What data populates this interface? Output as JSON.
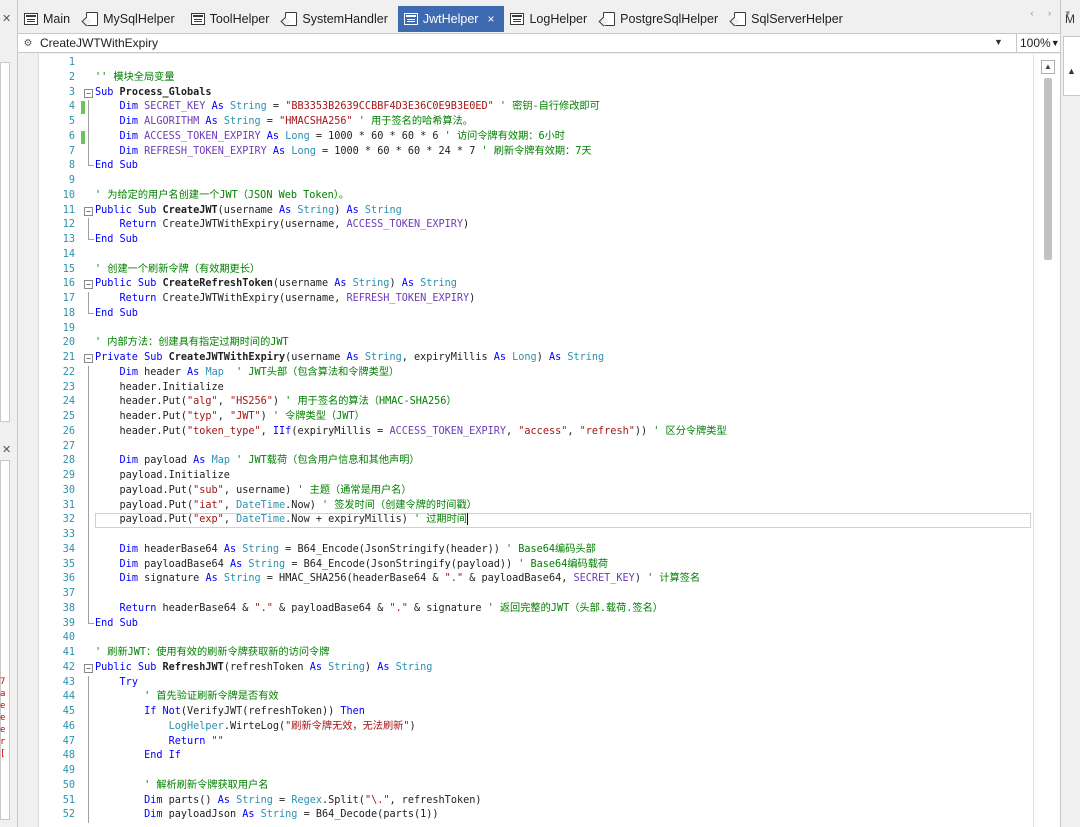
{
  "tabs": [
    {
      "label": "Main",
      "icon": "form-icon",
      "active": false
    },
    {
      "label": "MySqlHelper",
      "icon": "code-file-icon",
      "active": false
    },
    {
      "label": "ToolHelper",
      "icon": "form-icon",
      "active": false
    },
    {
      "label": "SystemHandler",
      "icon": "code-file-icon",
      "active": false
    },
    {
      "label": "JwtHelper",
      "icon": "form-icon",
      "active": true
    },
    {
      "label": "LogHelper",
      "icon": "form-icon",
      "active": false
    },
    {
      "label": "PostgreSqlHelper",
      "icon": "code-file-icon",
      "active": false
    },
    {
      "label": "SqlServerHelper",
      "icon": "code-file-icon",
      "active": false
    }
  ],
  "active_tab_close": "×",
  "member_bar": {
    "selected": "CreateJWTWithExpiry"
  },
  "zoom": {
    "value": "100%"
  },
  "side_panels": {
    "right_label": "M",
    "left_fragment": "7aeeer["
  },
  "accent_color": "#3d6ab0",
  "code": {
    "current_line": 32,
    "lines": [
      {
        "n": 1,
        "tokens": []
      },
      {
        "n": 2,
        "tokens": [
          [
            "c",
            "'' 模块全局变量"
          ]
        ]
      },
      {
        "n": 3,
        "fold": "minus",
        "tokens": [
          [
            "k",
            "Sub "
          ],
          [
            "b",
            "Process_Globals"
          ]
        ]
      },
      {
        "n": 4,
        "changed": true,
        "tokens": [
          [
            "p",
            "    "
          ],
          [
            "k",
            "Dim "
          ],
          [
            "v",
            "SECRET_KEY"
          ],
          [
            "k",
            " As "
          ],
          [
            "t",
            "String"
          ],
          [
            "p",
            " = "
          ],
          [
            "s",
            "\"BB3353B2639CCBBF4D3E36C0E9B3E0ED\""
          ],
          [
            "c",
            " ' 密钥-自行修改即可"
          ]
        ]
      },
      {
        "n": 5,
        "tokens": [
          [
            "p",
            "    "
          ],
          [
            "k",
            "Dim "
          ],
          [
            "v",
            "ALGORITHM"
          ],
          [
            "k",
            " As "
          ],
          [
            "t",
            "String"
          ],
          [
            "p",
            " = "
          ],
          [
            "s",
            "\"HMACSHA256\""
          ],
          [
            "c",
            " ' 用于签名的哈希算法。"
          ]
        ]
      },
      {
        "n": 6,
        "changed": true,
        "tokens": [
          [
            "p",
            "    "
          ],
          [
            "k",
            "Dim "
          ],
          [
            "v",
            "ACCESS_TOKEN_EXPIRY"
          ],
          [
            "k",
            " As "
          ],
          [
            "t",
            "Long"
          ],
          [
            "p",
            " = 1000 * 60 * 60 * 6"
          ],
          [
            "c",
            " ' 访问令牌有效期：6小时"
          ]
        ]
      },
      {
        "n": 7,
        "tokens": [
          [
            "p",
            "    "
          ],
          [
            "k",
            "Dim "
          ],
          [
            "v",
            "REFRESH_TOKEN_EXPIRY"
          ],
          [
            "k",
            " As "
          ],
          [
            "t",
            "Long"
          ],
          [
            "p",
            " = 1000 * 60 * 60 * 24 * 7"
          ],
          [
            "c",
            " ' 刷新令牌有效期：7天"
          ]
        ]
      },
      {
        "n": 8,
        "fold_end": true,
        "tokens": [
          [
            "k",
            "End Sub"
          ]
        ]
      },
      {
        "n": 9,
        "tokens": []
      },
      {
        "n": 10,
        "tokens": [
          [
            "c",
            "' 为给定的用户名创建一个JWT（JSON Web Token）。"
          ]
        ]
      },
      {
        "n": 11,
        "fold": "minus",
        "tokens": [
          [
            "k",
            "Public Sub "
          ],
          [
            "b",
            "CreateJWT"
          ],
          [
            "p",
            "(username "
          ],
          [
            "k",
            "As "
          ],
          [
            "t",
            "String"
          ],
          [
            "p",
            ") "
          ],
          [
            "k",
            "As "
          ],
          [
            "t",
            "String"
          ]
        ]
      },
      {
        "n": 12,
        "tokens": [
          [
            "p",
            "    "
          ],
          [
            "k",
            "Return "
          ],
          [
            "p",
            "CreateJWTWithExpiry(username, "
          ],
          [
            "v",
            "ACCESS_TOKEN_EXPIRY"
          ],
          [
            "p",
            ")"
          ]
        ]
      },
      {
        "n": 13,
        "fold_end": true,
        "tokens": [
          [
            "k",
            "End Sub"
          ]
        ]
      },
      {
        "n": 14,
        "tokens": []
      },
      {
        "n": 15,
        "tokens": [
          [
            "c",
            "' 创建一个刷新令牌（有效期更长）"
          ]
        ]
      },
      {
        "n": 16,
        "fold": "minus",
        "tokens": [
          [
            "k",
            "Public Sub "
          ],
          [
            "b",
            "CreateRefreshToken"
          ],
          [
            "p",
            "(username "
          ],
          [
            "k",
            "As "
          ],
          [
            "t",
            "String"
          ],
          [
            "p",
            ") "
          ],
          [
            "k",
            "As "
          ],
          [
            "t",
            "String"
          ]
        ]
      },
      {
        "n": 17,
        "tokens": [
          [
            "p",
            "    "
          ],
          [
            "k",
            "Return "
          ],
          [
            "p",
            "CreateJWTWithExpiry(username, "
          ],
          [
            "v",
            "REFRESH_TOKEN_EXPIRY"
          ],
          [
            "p",
            ")"
          ]
        ]
      },
      {
        "n": 18,
        "fold_end": true,
        "tokens": [
          [
            "k",
            "End Sub"
          ]
        ]
      },
      {
        "n": 19,
        "tokens": []
      },
      {
        "n": 20,
        "tokens": [
          [
            "c",
            "' 内部方法：创建具有指定过期时间的JWT"
          ]
        ]
      },
      {
        "n": 21,
        "fold": "minus",
        "tokens": [
          [
            "k",
            "Private Sub "
          ],
          [
            "b",
            "CreateJWTWithExpiry"
          ],
          [
            "p",
            "(username "
          ],
          [
            "k",
            "As "
          ],
          [
            "t",
            "String"
          ],
          [
            "p",
            ", expiryMillis "
          ],
          [
            "k",
            "As "
          ],
          [
            "t",
            "Long"
          ],
          [
            "p",
            ") "
          ],
          [
            "k",
            "As "
          ],
          [
            "t",
            "String"
          ]
        ]
      },
      {
        "n": 22,
        "tokens": [
          [
            "p",
            "    "
          ],
          [
            "k",
            "Dim "
          ],
          [
            "p",
            "header "
          ],
          [
            "k",
            "As "
          ],
          [
            "t",
            "Map"
          ],
          [
            "c",
            "  ' JWT头部（包含算法和令牌类型）"
          ]
        ]
      },
      {
        "n": 23,
        "tokens": [
          [
            "p",
            "    header.Initialize"
          ]
        ]
      },
      {
        "n": 24,
        "tokens": [
          [
            "p",
            "    header.Put("
          ],
          [
            "s",
            "\"alg\""
          ],
          [
            "p",
            ", "
          ],
          [
            "s",
            "\"HS256\""
          ],
          [
            "p",
            ")"
          ],
          [
            "c",
            " ' 用于签名的算法（HMAC-SHA256）"
          ]
        ]
      },
      {
        "n": 25,
        "tokens": [
          [
            "p",
            "    header.Put("
          ],
          [
            "s",
            "\"typ\""
          ],
          [
            "p",
            ", "
          ],
          [
            "s",
            "\"JWT\""
          ],
          [
            "p",
            ")"
          ],
          [
            "c",
            " ' 令牌类型（JWT）"
          ]
        ]
      },
      {
        "n": 26,
        "tokens": [
          [
            "p",
            "    header.Put("
          ],
          [
            "s",
            "\"token_type\""
          ],
          [
            "p",
            ", "
          ],
          [
            "k",
            "IIf"
          ],
          [
            "p",
            "(expiryMillis = "
          ],
          [
            "v",
            "ACCESS_TOKEN_EXPIRY"
          ],
          [
            "p",
            ", "
          ],
          [
            "s",
            "\"access\""
          ],
          [
            "p",
            ", "
          ],
          [
            "s",
            "\"refresh\""
          ],
          [
            "p",
            "))"
          ],
          [
            "c",
            " ' 区分令牌类型"
          ]
        ]
      },
      {
        "n": 27,
        "tokens": []
      },
      {
        "n": 28,
        "tokens": [
          [
            "p",
            "    "
          ],
          [
            "k",
            "Dim "
          ],
          [
            "p",
            "payload "
          ],
          [
            "k",
            "As "
          ],
          [
            "t",
            "Map"
          ],
          [
            "c",
            " ' JWT载荷（包含用户信息和其他声明）"
          ]
        ]
      },
      {
        "n": 29,
        "tokens": [
          [
            "p",
            "    payload.Initialize"
          ]
        ]
      },
      {
        "n": 30,
        "tokens": [
          [
            "p",
            "    payload.Put("
          ],
          [
            "s",
            "\"sub\""
          ],
          [
            "p",
            ", username)"
          ],
          [
            "c",
            " ' 主题（通常是用户名）"
          ]
        ]
      },
      {
        "n": 31,
        "tokens": [
          [
            "p",
            "    payload.Put("
          ],
          [
            "s",
            "\"iat\""
          ],
          [
            "p",
            ", "
          ],
          [
            "t",
            "DateTime"
          ],
          [
            "p",
            ".Now)"
          ],
          [
            "c",
            " ' 签发时间（创建令牌的时间戳）"
          ]
        ]
      },
      {
        "n": 32,
        "tokens": [
          [
            "p",
            "    payload.Put("
          ],
          [
            "s",
            "\"exp\""
          ],
          [
            "p",
            ", "
          ],
          [
            "t",
            "DateTime"
          ],
          [
            "p",
            ".Now + expiryMillis)"
          ],
          [
            "c",
            " ' 过期时间"
          ]
        ]
      },
      {
        "n": 33,
        "tokens": []
      },
      {
        "n": 34,
        "tokens": [
          [
            "p",
            "    "
          ],
          [
            "k",
            "Dim "
          ],
          [
            "p",
            "headerBase64 "
          ],
          [
            "k",
            "As "
          ],
          [
            "t",
            "String"
          ],
          [
            "p",
            " = B64_Encode(JsonStringify(header))"
          ],
          [
            "c",
            " ' Base64编码头部"
          ]
        ]
      },
      {
        "n": 35,
        "tokens": [
          [
            "p",
            "    "
          ],
          [
            "k",
            "Dim "
          ],
          [
            "p",
            "payloadBase64 "
          ],
          [
            "k",
            "As "
          ],
          [
            "t",
            "String"
          ],
          [
            "p",
            " = B64_Encode(JsonStringify(payload))"
          ],
          [
            "c",
            " ' Base64编码载荷"
          ]
        ]
      },
      {
        "n": 36,
        "tokens": [
          [
            "p",
            "    "
          ],
          [
            "k",
            "Dim "
          ],
          [
            "p",
            "signature "
          ],
          [
            "k",
            "As "
          ],
          [
            "t",
            "String"
          ],
          [
            "p",
            " = HMAC_SHA256(headerBase64 & "
          ],
          [
            "s",
            "\".\""
          ],
          [
            "p",
            " & payloadBase64, "
          ],
          [
            "v",
            "SECRET_KEY"
          ],
          [
            "p",
            ")"
          ],
          [
            "c",
            " ' 计算签名"
          ]
        ]
      },
      {
        "n": 37,
        "tokens": []
      },
      {
        "n": 38,
        "tokens": [
          [
            "p",
            "    "
          ],
          [
            "k",
            "Return "
          ],
          [
            "p",
            "headerBase64 & "
          ],
          [
            "s",
            "\".\""
          ],
          [
            "p",
            " & payloadBase64 & "
          ],
          [
            "s",
            "\".\""
          ],
          [
            "p",
            " & signature"
          ],
          [
            "c",
            " ' 返回完整的JWT（头部.载荷.签名）"
          ]
        ]
      },
      {
        "n": 39,
        "fold_end": true,
        "tokens": [
          [
            "k",
            "End Sub"
          ]
        ]
      },
      {
        "n": 40,
        "tokens": []
      },
      {
        "n": 41,
        "tokens": [
          [
            "c",
            "' 刷新JWT：使用有效的刷新令牌获取新的访问令牌"
          ]
        ]
      },
      {
        "n": 42,
        "fold": "minus",
        "tokens": [
          [
            "k",
            "Public Sub "
          ],
          [
            "b",
            "RefreshJWT"
          ],
          [
            "p",
            "(refreshToken "
          ],
          [
            "k",
            "As "
          ],
          [
            "t",
            "String"
          ],
          [
            "p",
            ") "
          ],
          [
            "k",
            "As "
          ],
          [
            "t",
            "String"
          ]
        ]
      },
      {
        "n": 43,
        "tokens": [
          [
            "p",
            "    "
          ],
          [
            "k",
            "Try"
          ]
        ]
      },
      {
        "n": 44,
        "tokens": [
          [
            "p",
            "        "
          ],
          [
            "c",
            "' 首先验证刷新令牌是否有效"
          ]
        ]
      },
      {
        "n": 45,
        "tokens": [
          [
            "p",
            "        "
          ],
          [
            "k",
            "If Not"
          ],
          [
            "p",
            "(VerifyJWT(refreshToken)) "
          ],
          [
            "k",
            "Then"
          ]
        ]
      },
      {
        "n": 46,
        "tokens": [
          [
            "p",
            "            "
          ],
          [
            "t",
            "LogHelper"
          ],
          [
            "p",
            ".WirteLog("
          ],
          [
            "s",
            "\"刷新令牌无效，无法刷新\""
          ],
          [
            "p",
            ")"
          ]
        ]
      },
      {
        "n": 47,
        "tokens": [
          [
            "p",
            "            "
          ],
          [
            "k",
            "Return "
          ],
          [
            "s",
            "\"\""
          ]
        ]
      },
      {
        "n": 48,
        "tokens": [
          [
            "p",
            "        "
          ],
          [
            "k",
            "End If"
          ]
        ]
      },
      {
        "n": 49,
        "tokens": []
      },
      {
        "n": 50,
        "tokens": [
          [
            "p",
            "        "
          ],
          [
            "c",
            "' 解析刷新令牌获取用户名"
          ]
        ]
      },
      {
        "n": 51,
        "tokens": [
          [
            "p",
            "        "
          ],
          [
            "k",
            "Dim "
          ],
          [
            "p",
            "parts() "
          ],
          [
            "k",
            "As "
          ],
          [
            "t",
            "String"
          ],
          [
            "p",
            " = "
          ],
          [
            "t",
            "Regex"
          ],
          [
            "p",
            ".Split("
          ],
          [
            "s",
            "\"\\.\""
          ],
          [
            "p",
            ", refreshToken)"
          ]
        ]
      },
      {
        "n": 52,
        "tokens": [
          [
            "p",
            "        "
          ],
          [
            "k",
            "Dim "
          ],
          [
            "p",
            "payloadJson "
          ],
          [
            "k",
            "As "
          ],
          [
            "t",
            "String"
          ],
          [
            "p",
            " = B64_Decode(parts(1))"
          ]
        ]
      }
    ]
  }
}
